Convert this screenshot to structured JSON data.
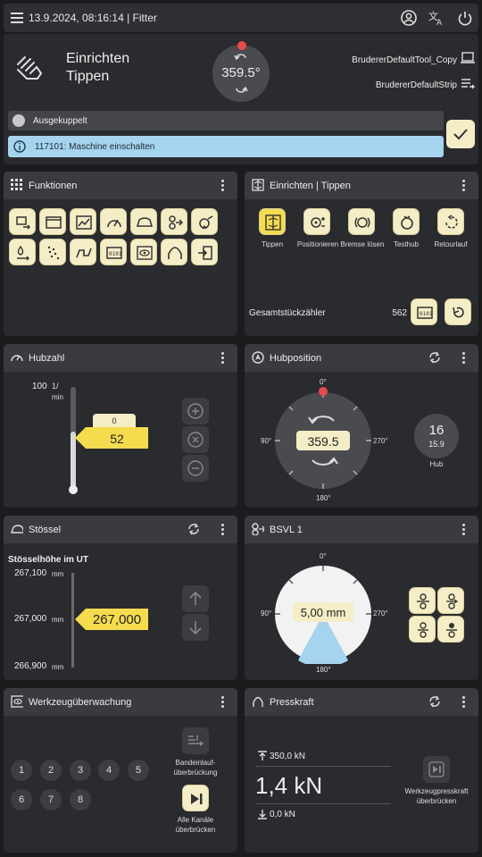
{
  "topbar": {
    "title": "13.9.2024, 08:16:14 | Fitter"
  },
  "header": {
    "mode1": "Einrichten",
    "mode2": "Tippen",
    "angle": "359.5°",
    "tool": "BrudererDefaultTool_Copy",
    "strip": "BrudererDefaultStrip",
    "status": "Ausgekuppelt",
    "message": "117101: Maschine einschalten"
  },
  "funktionen": {
    "title": "Funktionen"
  },
  "einrichten": {
    "title": "Einrichten | Tippen",
    "buttons": [
      "Tippen",
      "Positionieren",
      "Bremse lösen",
      "Testhub",
      "Retourlauf"
    ],
    "counter_label": "Gesamtstückzähler",
    "counter_value": "562"
  },
  "hubzahl": {
    "title": "Hubzahl",
    "max": "100",
    "unit_top": "1/",
    "unit_bottom": "min",
    "set": "0",
    "value": "52"
  },
  "hubposition": {
    "title": "Hubposition",
    "deg0": "0°",
    "deg90": "90°",
    "deg180": "180°",
    "deg270": "270°",
    "value": "359.5",
    "hub": "16",
    "hub_sub": "15.9",
    "hub_label": "Hub"
  },
  "stoessel": {
    "title": "Stössel",
    "subtitle": "Stösselhöhe im UT",
    "t1": "267,100",
    "t2": "267,000",
    "t3": "266,900",
    "unit": "mm",
    "value": "267,000"
  },
  "bsvl": {
    "title": "BSVL 1",
    "deg0": "0°",
    "deg90": "90°",
    "deg180": "180°",
    "deg270": "270°",
    "value": "5,00 mm"
  },
  "werkzeug": {
    "title": "Werkzeugüberwachung",
    "channels": [
      "1",
      "2",
      "3",
      "4",
      "5",
      "6",
      "7",
      "8"
    ],
    "btn1_l1": "Bandeinlauf-",
    "btn1_l2": "überbrückung",
    "btn2_l1": "Alle Kanäle",
    "btn2_l2": "überbrücken"
  },
  "presskraft": {
    "title": "Presskraft",
    "max": "350,0 kN",
    "value": "1,4 kN",
    "min": "0,0 kN",
    "btn_l1": "Werkzeugpresskraft",
    "btn_l2": "überbrücken"
  },
  "colors": {
    "accent": "#f5dc4f",
    "info": "#a6d4ee",
    "red": "#e84a4a"
  }
}
